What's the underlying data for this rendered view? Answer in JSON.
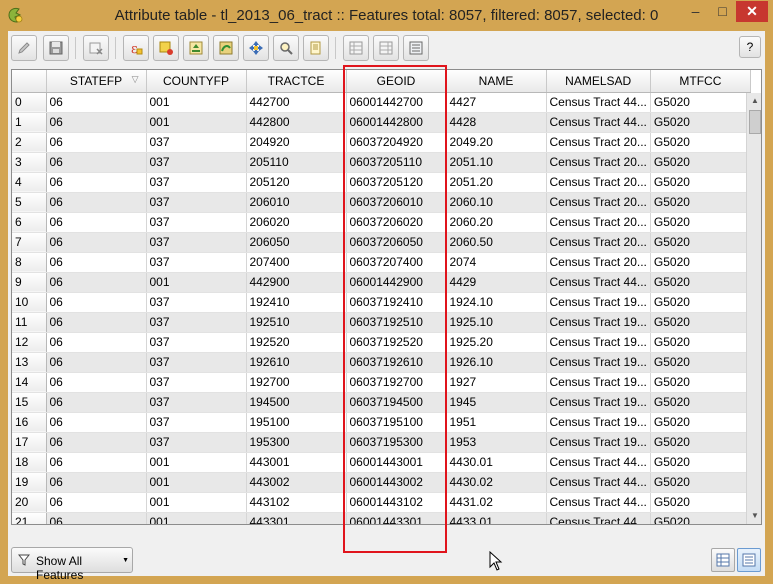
{
  "window": {
    "title": "Attribute table - tl_2013_06_tract :: Features total: 8057, filtered: 8057, selected: 0",
    "minimize": "–",
    "maximize": "□",
    "close": "✕"
  },
  "toolbar": {
    "buttons": [
      {
        "name": "toggle-editing-icon",
        "color": "#a0a0a0"
      },
      {
        "name": "save-edits-icon",
        "color": "#7d7d7d"
      },
      {
        "name": "delete-selected-icon",
        "color": "#9a9a9a"
      },
      {
        "name": "expression-select-icon",
        "color": "#d13b2a"
      },
      {
        "name": "unselect-all-icon",
        "color": "#e3b323"
      },
      {
        "name": "move-selection-to-top-icon",
        "color": "#3f8a2d"
      },
      {
        "name": "invert-selection-icon",
        "color": "#2f8f33"
      },
      {
        "name": "pan-to-selected-icon",
        "color": "#3b6db6"
      },
      {
        "name": "zoom-to-selected-icon",
        "color": "#c59b1f"
      },
      {
        "name": "copy-rows-icon",
        "color": "#d9b53a"
      },
      {
        "name": "delete-column-icon",
        "color": "#9a9a9a"
      },
      {
        "name": "new-column-icon",
        "color": "#9a9a9a"
      },
      {
        "name": "field-calculator-icon",
        "color": "#6a6a6a"
      }
    ],
    "help_label": "?"
  },
  "table": {
    "columns": [
      "STATEFP",
      "COUNTYFP",
      "TRACTCE",
      "GEOID",
      "NAME",
      "NAMELSAD",
      "MTFCC"
    ],
    "sort_indicator": "▽",
    "rows": [
      [
        "0",
        "06",
        "001",
        "442700",
        "06001442700",
        "4427",
        "Census Tract 44...",
        "G5020"
      ],
      [
        "1",
        "06",
        "001",
        "442800",
        "06001442800",
        "4428",
        "Census Tract 44...",
        "G5020"
      ],
      [
        "2",
        "06",
        "037",
        "204920",
        "06037204920",
        "2049.20",
        "Census Tract 20...",
        "G5020"
      ],
      [
        "3",
        "06",
        "037",
        "205110",
        "06037205110",
        "2051.10",
        "Census Tract 20...",
        "G5020"
      ],
      [
        "4",
        "06",
        "037",
        "205120",
        "06037205120",
        "2051.20",
        "Census Tract 20...",
        "G5020"
      ],
      [
        "5",
        "06",
        "037",
        "206010",
        "06037206010",
        "2060.10",
        "Census Tract 20...",
        "G5020"
      ],
      [
        "6",
        "06",
        "037",
        "206020",
        "06037206020",
        "2060.20",
        "Census Tract 20...",
        "G5020"
      ],
      [
        "7",
        "06",
        "037",
        "206050",
        "06037206050",
        "2060.50",
        "Census Tract 20...",
        "G5020"
      ],
      [
        "8",
        "06",
        "037",
        "207400",
        "06037207400",
        "2074",
        "Census Tract 20...",
        "G5020"
      ],
      [
        "9",
        "06",
        "001",
        "442900",
        "06001442900",
        "4429",
        "Census Tract 44...",
        "G5020"
      ],
      [
        "10",
        "06",
        "037",
        "192410",
        "06037192410",
        "1924.10",
        "Census Tract 19...",
        "G5020"
      ],
      [
        "11",
        "06",
        "037",
        "192510",
        "06037192510",
        "1925.10",
        "Census Tract 19...",
        "G5020"
      ],
      [
        "12",
        "06",
        "037",
        "192520",
        "06037192520",
        "1925.20",
        "Census Tract 19...",
        "G5020"
      ],
      [
        "13",
        "06",
        "037",
        "192610",
        "06037192610",
        "1926.10",
        "Census Tract 19...",
        "G5020"
      ],
      [
        "14",
        "06",
        "037",
        "192700",
        "06037192700",
        "1927",
        "Census Tract 19...",
        "G5020"
      ],
      [
        "15",
        "06",
        "037",
        "194500",
        "06037194500",
        "1945",
        "Census Tract 19...",
        "G5020"
      ],
      [
        "16",
        "06",
        "037",
        "195100",
        "06037195100",
        "1951",
        "Census Tract 19...",
        "G5020"
      ],
      [
        "17",
        "06",
        "037",
        "195300",
        "06037195300",
        "1953",
        "Census Tract 19...",
        "G5020"
      ],
      [
        "18",
        "06",
        "001",
        "443001",
        "06001443001",
        "4430.01",
        "Census Tract 44...",
        "G5020"
      ],
      [
        "19",
        "06",
        "001",
        "443002",
        "06001443002",
        "4430.02",
        "Census Tract 44...",
        "G5020"
      ],
      [
        "20",
        "06",
        "001",
        "443102",
        "06001443102",
        "4431.02",
        "Census Tract 44...",
        "G5020"
      ],
      [
        "21",
        "06",
        "001",
        "443301",
        "06001443301",
        "4433.01",
        "Census Tract 44...",
        "G5020"
      ]
    ]
  },
  "footer": {
    "show_features_label": "Show All Features",
    "filter_icon": "filter-icon",
    "table_view_icon": "table-view-icon",
    "form_view_icon": "form-view-icon"
  },
  "colors": {
    "window_frame": "#d3a552",
    "close_button": "#c7372f",
    "highlight": "#e0141c",
    "alt_row": "#e8e8e8"
  }
}
